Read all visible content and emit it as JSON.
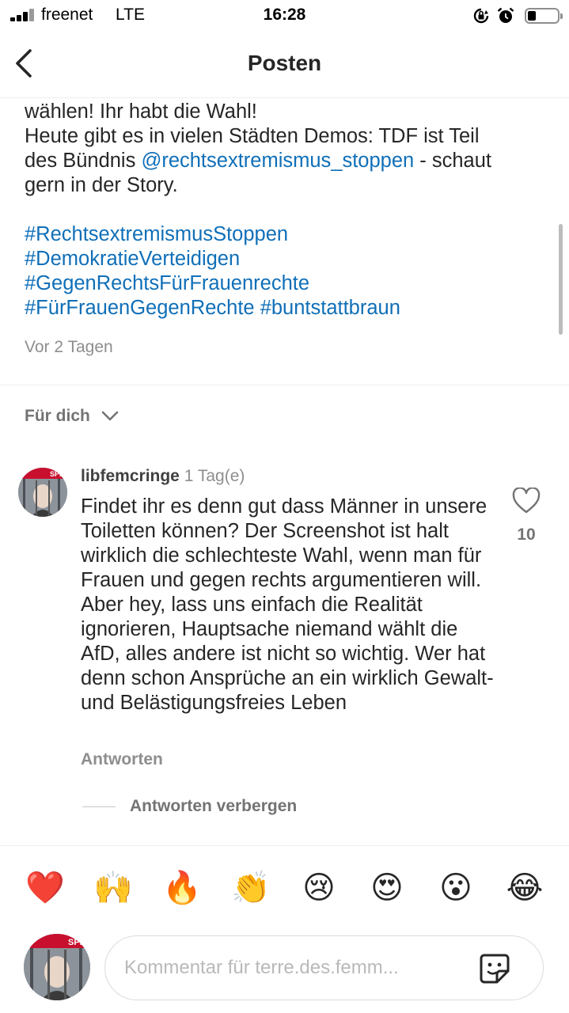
{
  "status_bar": {
    "carrier": "freenet",
    "network": "LTE",
    "time": "16:28",
    "battery_level": 0.25
  },
  "header": {
    "title": "Posten"
  },
  "caption": {
    "line1": "wählen! Ihr habt die Wahl!",
    "line2": "Heute gibt es in vielen Städten Demos: TDF ist Teil",
    "line3_prefix": "des Bündnis ",
    "mention": "@rechtsextremismus_stoppen",
    "line3_suffix": " - schaut",
    "line4": "gern in der Story.",
    "hashtags": [
      "#RechtsextremismusStoppen",
      "#DemokratieVerteidigen",
      "#GegenRechtsFürFrauenrechte",
      "#FürFrauenGegenRechte",
      "#buntstattbraun"
    ],
    "posted": "Vor 2 Tagen"
  },
  "sort": {
    "label": "Für dich"
  },
  "comment": {
    "username": "libfemcringe",
    "time": "1 Tag(e)",
    "text": "Findet ihr es denn gut dass Männer in unsere Toiletten können? Der Screenshot ist halt wirklich die schlechteste Wahl, wenn man für Frauen und gegen rechts argumentieren will. Aber hey, lass uns einfach die Realität ignorieren, Hauptsache niemand wählt die AfD, alles andere ist nicht so wichtig. Wer hat denn schon Ansprüche an ein wirklich Gewalt- und Belästigungsfreies Leben",
    "reply_label": "Antworten",
    "likes": "10",
    "hide_replies_label": "Antworten verbergen",
    "avatar_badge": "SPD"
  },
  "emoji_bar": [
    "❤️",
    "🙌",
    "🔥",
    "👏",
    "😢",
    "😍",
    "😮",
    "😂"
  ],
  "composer": {
    "placeholder": "Kommentar für terre.des.femm...",
    "avatar_badge": "SPD"
  },
  "colors": {
    "link": "#0f6fb8",
    "muted": "#8e8e8e"
  }
}
